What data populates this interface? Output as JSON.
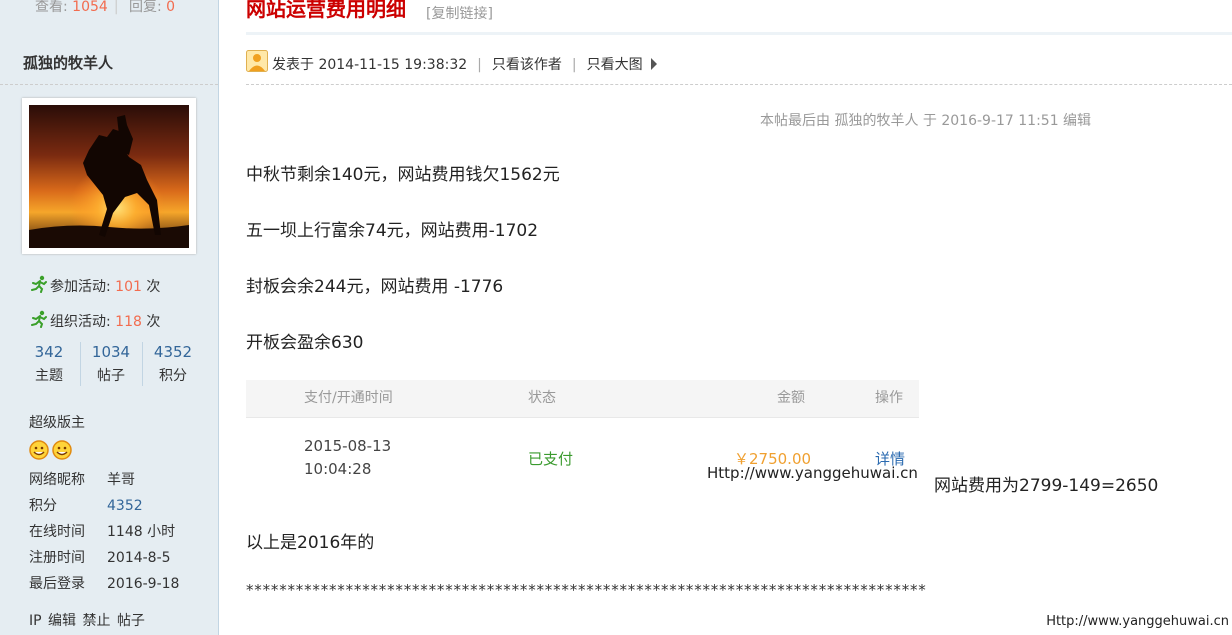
{
  "thread": {
    "views_label": "查看:",
    "views": "1054",
    "replies_label": "回复:",
    "replies": "0",
    "title": "网站运营费用明细",
    "copy_link": "[复制链接]"
  },
  "author": {
    "name": "孤独的牧羊人",
    "activities": [
      {
        "label": "参加活动:",
        "value": "101",
        "unit": "次"
      },
      {
        "label": "组织活动:",
        "value": "118",
        "unit": "次"
      }
    ],
    "counts": [
      {
        "value": "342",
        "label": "主题"
      },
      {
        "value": "1034",
        "label": "帖子"
      },
      {
        "value": "4352",
        "label": "积分"
      }
    ],
    "rank": "超级版主",
    "info": [
      {
        "key": "网络昵称",
        "value": "羊哥"
      },
      {
        "key": "积分",
        "value": "4352"
      },
      {
        "key": "在线时间",
        "value": "1148 小时"
      },
      {
        "key": "注册时间",
        "value": "2014-8-5"
      },
      {
        "key": "最后登录",
        "value": "2016-9-18"
      }
    ],
    "admin_links": [
      "IP",
      "编辑",
      "禁止",
      "帖子"
    ]
  },
  "post": {
    "posted_at": "发表于 2014-11-15 19:38:32",
    "only_author": "只看该作者",
    "only_large_images": "只看大图",
    "last_edit": "本帖最后由 孤独的牧羊人 于 2016-9-17 11:51 编辑",
    "paragraphs": [
      "中秋节剩余140元，网站费用钱欠1562元",
      "五一坝上行富余74元，网站费用-1702",
      "封板会余244元，网站费用 -1776",
      "开板会盈余630"
    ],
    "order": {
      "headers": [
        "支付/开通时间",
        "状态",
        "金额",
        "操作"
      ],
      "date": "2015-08-13",
      "time": "10:04:28",
      "status": "已支付",
      "amount": "￥2750.00",
      "action": "详情"
    },
    "image_watermark": "Http://www.yanggehuwai.cn",
    "fee_note": "网站费用为2799-149=2650",
    "year_note": "以上是2016年的",
    "separator": "**********************************************************************************",
    "corner_watermark": "Http://www.yanggehuwai.cn"
  },
  "colors": {
    "accent_orange": "#f26c4f",
    "title_red": "#cc0000",
    "link_blue": "#336699",
    "paid_green": "#3a9a2e",
    "amount_orange": "#f0a030",
    "sidebar_bg": "#e5edf2"
  },
  "icons": {
    "activity": "running-man-icon",
    "medal": "smiley-medal-icon",
    "poster": "user-avatar-icon",
    "more": "triangle-right-icon"
  }
}
